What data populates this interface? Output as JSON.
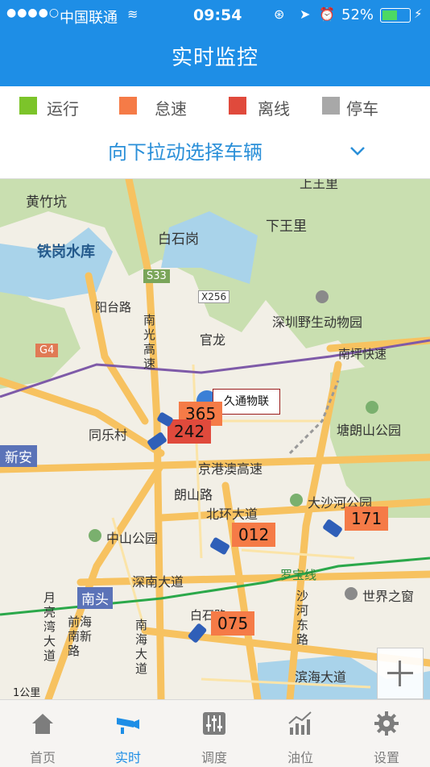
{
  "status_bar": {
    "carrier": "中国联通",
    "time": "09:54",
    "battery": "52%"
  },
  "nav": {
    "title": "实时监控"
  },
  "legend": [
    {
      "label": "运行",
      "color": "#7cc42a"
    },
    {
      "label": "怠速",
      "color": "#f57b47"
    },
    {
      "label": "离线",
      "color": "#e04a3c"
    },
    {
      "label": "停车",
      "color": "#a8a8a8"
    }
  ],
  "selector": {
    "label": "向下拉动选择车辆",
    "icon": "chevron-down-icon"
  },
  "map": {
    "place_labels": [
      "黄竹坑",
      "白石岗",
      "下王里",
      "铁岗水库",
      "S33",
      "X256",
      "深圳野生动物园",
      "G4",
      "南坪快速",
      "官龙",
      "久通物联",
      "同乐村",
      "新安",
      "京港澳高速",
      "塘朗山公园",
      "朗山路",
      "北环大道",
      "大沙河公园",
      "中山公园",
      "深南大道",
      "罗宝线",
      "南头",
      "世界之窗",
      "月亮湾大道",
      "前海南新路",
      "南海大道",
      "白石路",
      "沙河东路",
      "滨海大道",
      "南光高速",
      "阳台路",
      "上王里"
    ],
    "vehicle_tags": [
      {
        "number": "365",
        "color": "#f57b47"
      },
      {
        "number": "242",
        "color": "#e04a3c"
      },
      {
        "number": "012",
        "color": "#f57b47"
      },
      {
        "number": "171",
        "color": "#f57b47"
      },
      {
        "number": "075",
        "color": "#f57b47"
      }
    ],
    "scale": "1公里"
  },
  "tabs": [
    {
      "label": "首页",
      "icon": "home-icon"
    },
    {
      "label": "实时",
      "icon": "camera-icon"
    },
    {
      "label": "调度",
      "icon": "sliders-icon"
    },
    {
      "label": "油位",
      "icon": "chart-icon"
    },
    {
      "label": "设置",
      "icon": "gear-icon"
    }
  ]
}
